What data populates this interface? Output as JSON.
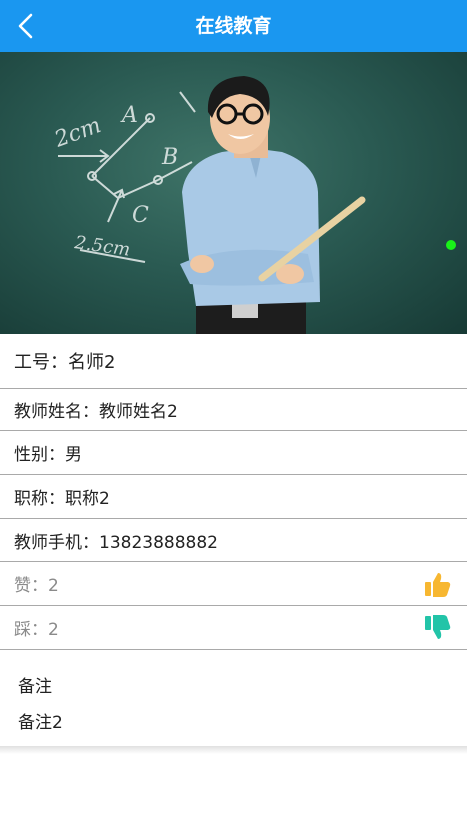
{
  "header": {
    "title": "在线教育",
    "back_icon": "chevron-left-icon",
    "background": "#1a97f0"
  },
  "hero": {
    "description": "teacher standing in front of a green chalkboard holding a pointer",
    "indicator_color": "#19f219",
    "chalk_labels": [
      "2cm",
      "A",
      "B",
      "C",
      "2.5cm"
    ]
  },
  "details": {
    "job_no": "工号：名师2",
    "teacher_name": "教师姓名：教师姓名2",
    "gender": "性别：男",
    "title": "职称：职称2",
    "phone": "教师手机：13823888882",
    "likes": "赞：2",
    "dislikes": "踩：2"
  },
  "icons": {
    "like": "thumbs-up-icon",
    "like_color": "#f7b731",
    "dislike": "thumbs-down-icon",
    "dislike_color": "#22c4a8"
  },
  "note": {
    "title": "备注",
    "body": "备注2"
  }
}
